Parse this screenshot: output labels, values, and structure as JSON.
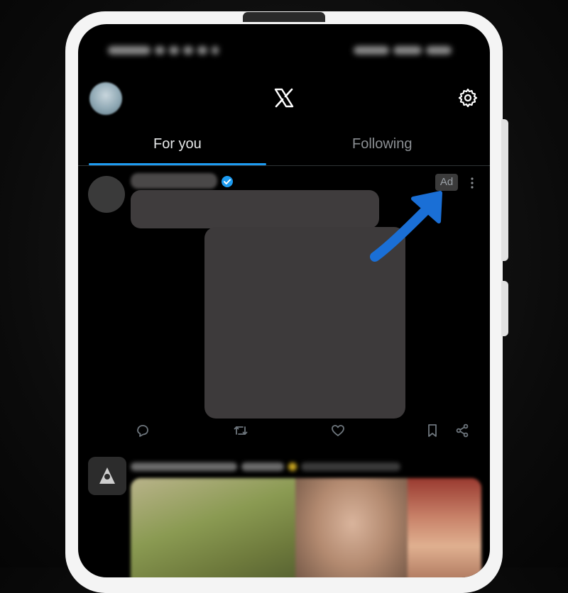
{
  "header": {
    "logo": "x-logo",
    "settings_icon": "gear-icon"
  },
  "tabs": [
    {
      "label": "For you",
      "active": true
    },
    {
      "label": "Following",
      "active": false
    }
  ],
  "post": {
    "ad_label": "Ad",
    "verified_icon": "verified-badge-icon",
    "actions": [
      "reply-icon",
      "repost-icon",
      "like-icon",
      "bookmark-icon",
      "share-icon"
    ]
  },
  "colors": {
    "background": "#000000",
    "accent": "#1d9bf0",
    "annotation_arrow": "#1a6fd6",
    "tab_active": "#e7e9ea",
    "tab_inactive": "#8b8f93"
  }
}
